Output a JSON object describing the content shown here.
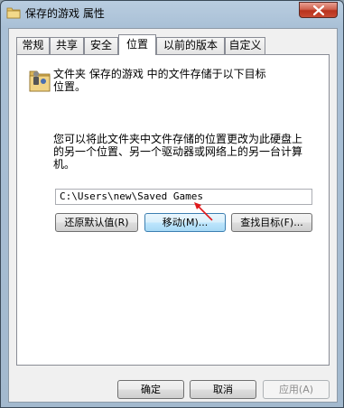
{
  "window": {
    "title": "保存的游戏 属性"
  },
  "tabs": [
    {
      "label": "常规"
    },
    {
      "label": "共享"
    },
    {
      "label": "安全"
    },
    {
      "label": "位置"
    },
    {
      "label": "以前的版本"
    },
    {
      "label": "自定义"
    }
  ],
  "active_tab": "位置",
  "location": {
    "description_line1": "文件夹 保存的游戏 中的文件存储于以下目标",
    "description_line2": "位置。",
    "info_line1": "您可以将此文件夹中文件存储的位置更改为此硬盘上",
    "info_line2": "的另一个位置、另一个驱动器或网络上的另一台计算",
    "info_line3": "机。",
    "path_value": "C:\\Users\\new\\Saved Games",
    "restore_default_label": "还原默认值(R)",
    "move_label": "移动(M)...",
    "find_target_label": "查找目标(F)..."
  },
  "footer": {
    "ok_label": "确定",
    "cancel_label": "取消",
    "apply_label": "应用(A)"
  },
  "colors": {
    "annotation_arrow": "#e0191b",
    "close_button": "#c84a33"
  },
  "icons": [
    "folder-icon",
    "close-icon",
    "red-arrow-annotation"
  ]
}
